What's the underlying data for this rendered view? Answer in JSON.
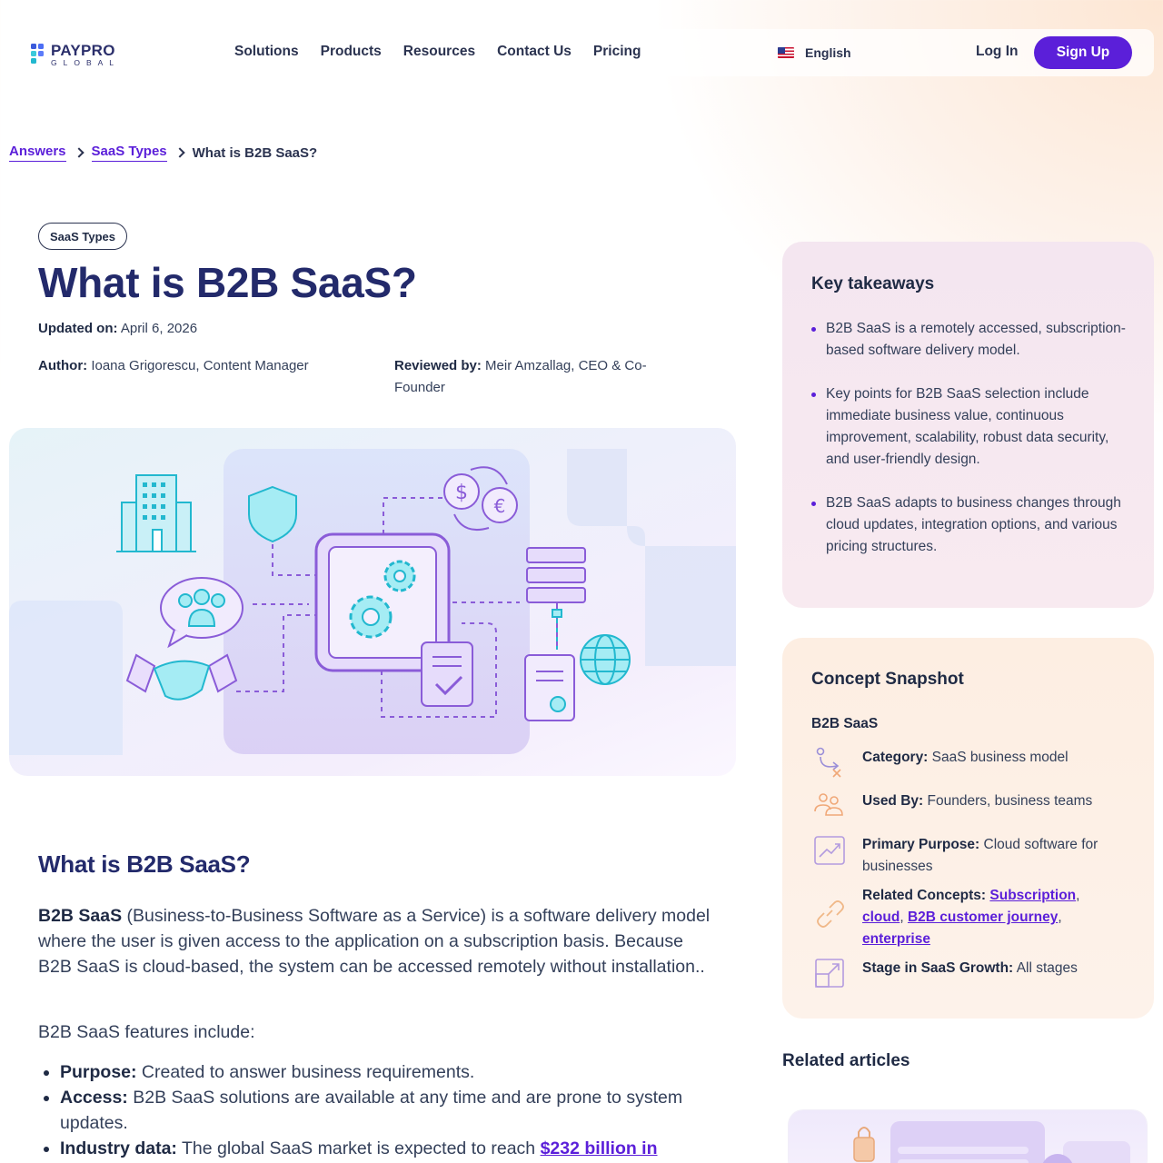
{
  "header": {
    "logo_top": "PAYPRO",
    "logo_bottom": "GLOBAL",
    "nav": [
      "Solutions",
      "Products",
      "Resources",
      "Contact Us",
      "Pricing"
    ],
    "language": "English",
    "login": "Log In",
    "signup": "Sign Up"
  },
  "breadcrumb": {
    "items": [
      "Answers",
      "SaaS Types"
    ],
    "current": "What is B2B SaaS?"
  },
  "article": {
    "tag": "SaaS Types",
    "title": "What is B2B SaaS?",
    "updated_label": "Updated on:",
    "updated_value": "April 6, 2026",
    "author_label": "Author:",
    "author_value": "Ioana Grigorescu, Content Manager",
    "reviewer_label": "Reviewed by:",
    "reviewer_value": "Meir Amzallag, CEO & Co-Founder",
    "section_title": "What is B2B SaaS?",
    "intro_bold": "B2B SaaS",
    "intro_rest": " (Business-to-Business Software as a Service) is a software delivery model where the user is given access to the application on a subscription basis. Because B2B SaaS is cloud-based, the system can be accessed remotely without installation..",
    "features_intro": "B2B SaaS features include:",
    "features": [
      {
        "label": "Purpose:",
        "text": " Created to answer business requirements."
      },
      {
        "label": "Access:",
        "text": " B2B SaaS solutions are available at any time and are prone to system updates."
      },
      {
        "label": "Industry data:",
        "text": " The global SaaS market is expected to reach ",
        "link": "$232 billion in"
      }
    ]
  },
  "takeaways": {
    "title": "Key takeaways",
    "items": [
      "B2B SaaS is a remotely accessed, subscription-based software delivery model.",
      "Key points for B2B SaaS selection include immediate business value, continuous improvement, scalability, robust data security, and user-friendly design.",
      "B2B SaaS adapts to business changes through cloud updates, integration options, and various pricing structures."
    ]
  },
  "snapshot": {
    "title": "Concept Snapshot",
    "subject": "B2B SaaS",
    "category_label": "Category:",
    "category_value": "SaaS business model",
    "used_by_label": "Used By:",
    "used_by_value": "Founders, business teams",
    "purpose_label": "Primary Purpose:",
    "purpose_value": "Cloud software for businesses",
    "related_label": "Related Concepts:",
    "related_links": [
      "Subscription",
      "cloud",
      "B2B customer journey",
      "enterprise"
    ],
    "stage_label": "Stage in SaaS Growth:",
    "stage_value": "All stages"
  },
  "related": {
    "title": "Related articles"
  },
  "colors": {
    "accent": "#5b1fd9",
    "heading": "#232a6b",
    "text": "#34405a"
  },
  "icons": [
    "category-icon",
    "users-icon",
    "chart-icon",
    "link-icon",
    "stage-icon",
    "chevron-right-icon",
    "us-flag-icon"
  ]
}
